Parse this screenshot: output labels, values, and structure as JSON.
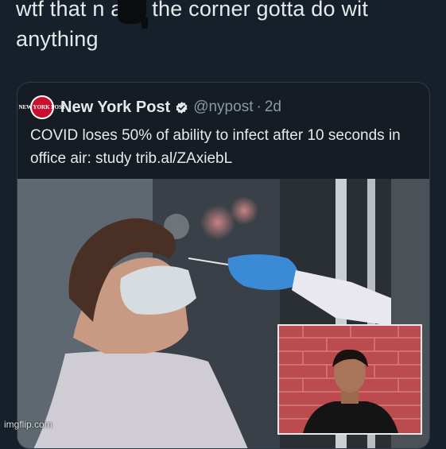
{
  "caption": "wtf that n    a in the corner gotta do wit anything",
  "tweet": {
    "account_name": "New York Post",
    "handle": "@nypost",
    "separator": "·",
    "age": "2d",
    "logo_text": "NEW YORK POST",
    "text": "COVID loses 50% of ability to infect after 10 seconds in office air: study trib.al/ZAxiebL"
  },
  "watermark": "imgflip.com",
  "colors": {
    "background": "#15202b",
    "logo": "#c8102e",
    "verified": "#1d9bf0",
    "secondary_text": "#8b98a5"
  },
  "icons": {
    "verified": "verified-badge-icon",
    "logo": "nypost-logo"
  }
}
